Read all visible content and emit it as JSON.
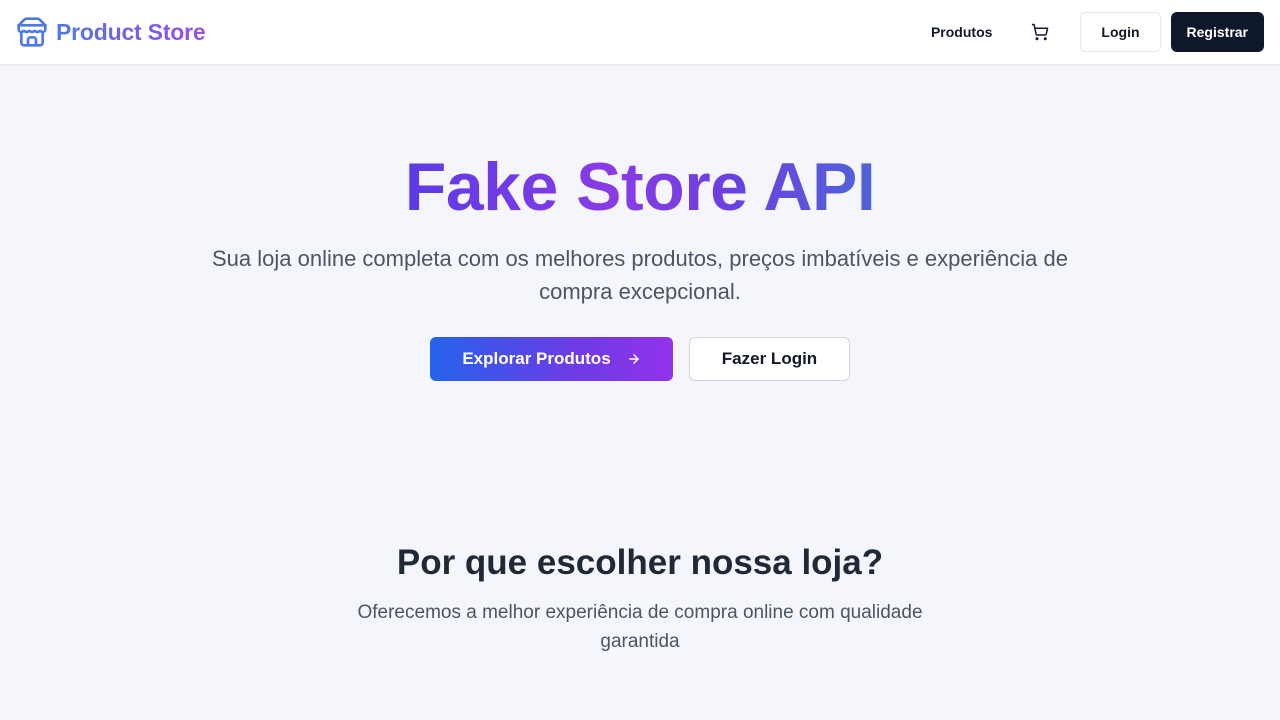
{
  "header": {
    "brand_name": "Product Store",
    "brand_icon": "store-icon",
    "nav_products": "Produtos",
    "cart_icon": "shopping-cart-icon",
    "login_label": "Login",
    "register_label": "Registrar"
  },
  "hero": {
    "title": "Fake Store API",
    "subtitle": "Sua loja online completa com os melhores produtos, preços imbatíveis e experiência de compra excepcional.",
    "explore_label": "Explorar Produtos",
    "explore_icon": "arrow-right-icon",
    "login_label": "Fazer Login"
  },
  "features": {
    "title": "Por que escolher nossa loja?",
    "subtitle": "Oferecemos a melhor experiência de compra online com qualidade garantida"
  },
  "colors": {
    "brand_gradient_start": "#4f7ae6",
    "brand_gradient_end": "#9b4fe0",
    "hero_button_start": "#2563eb",
    "hero_button_end": "#9333ea",
    "dark_button": "#0f172a",
    "page_background": "#f4f6fb"
  }
}
